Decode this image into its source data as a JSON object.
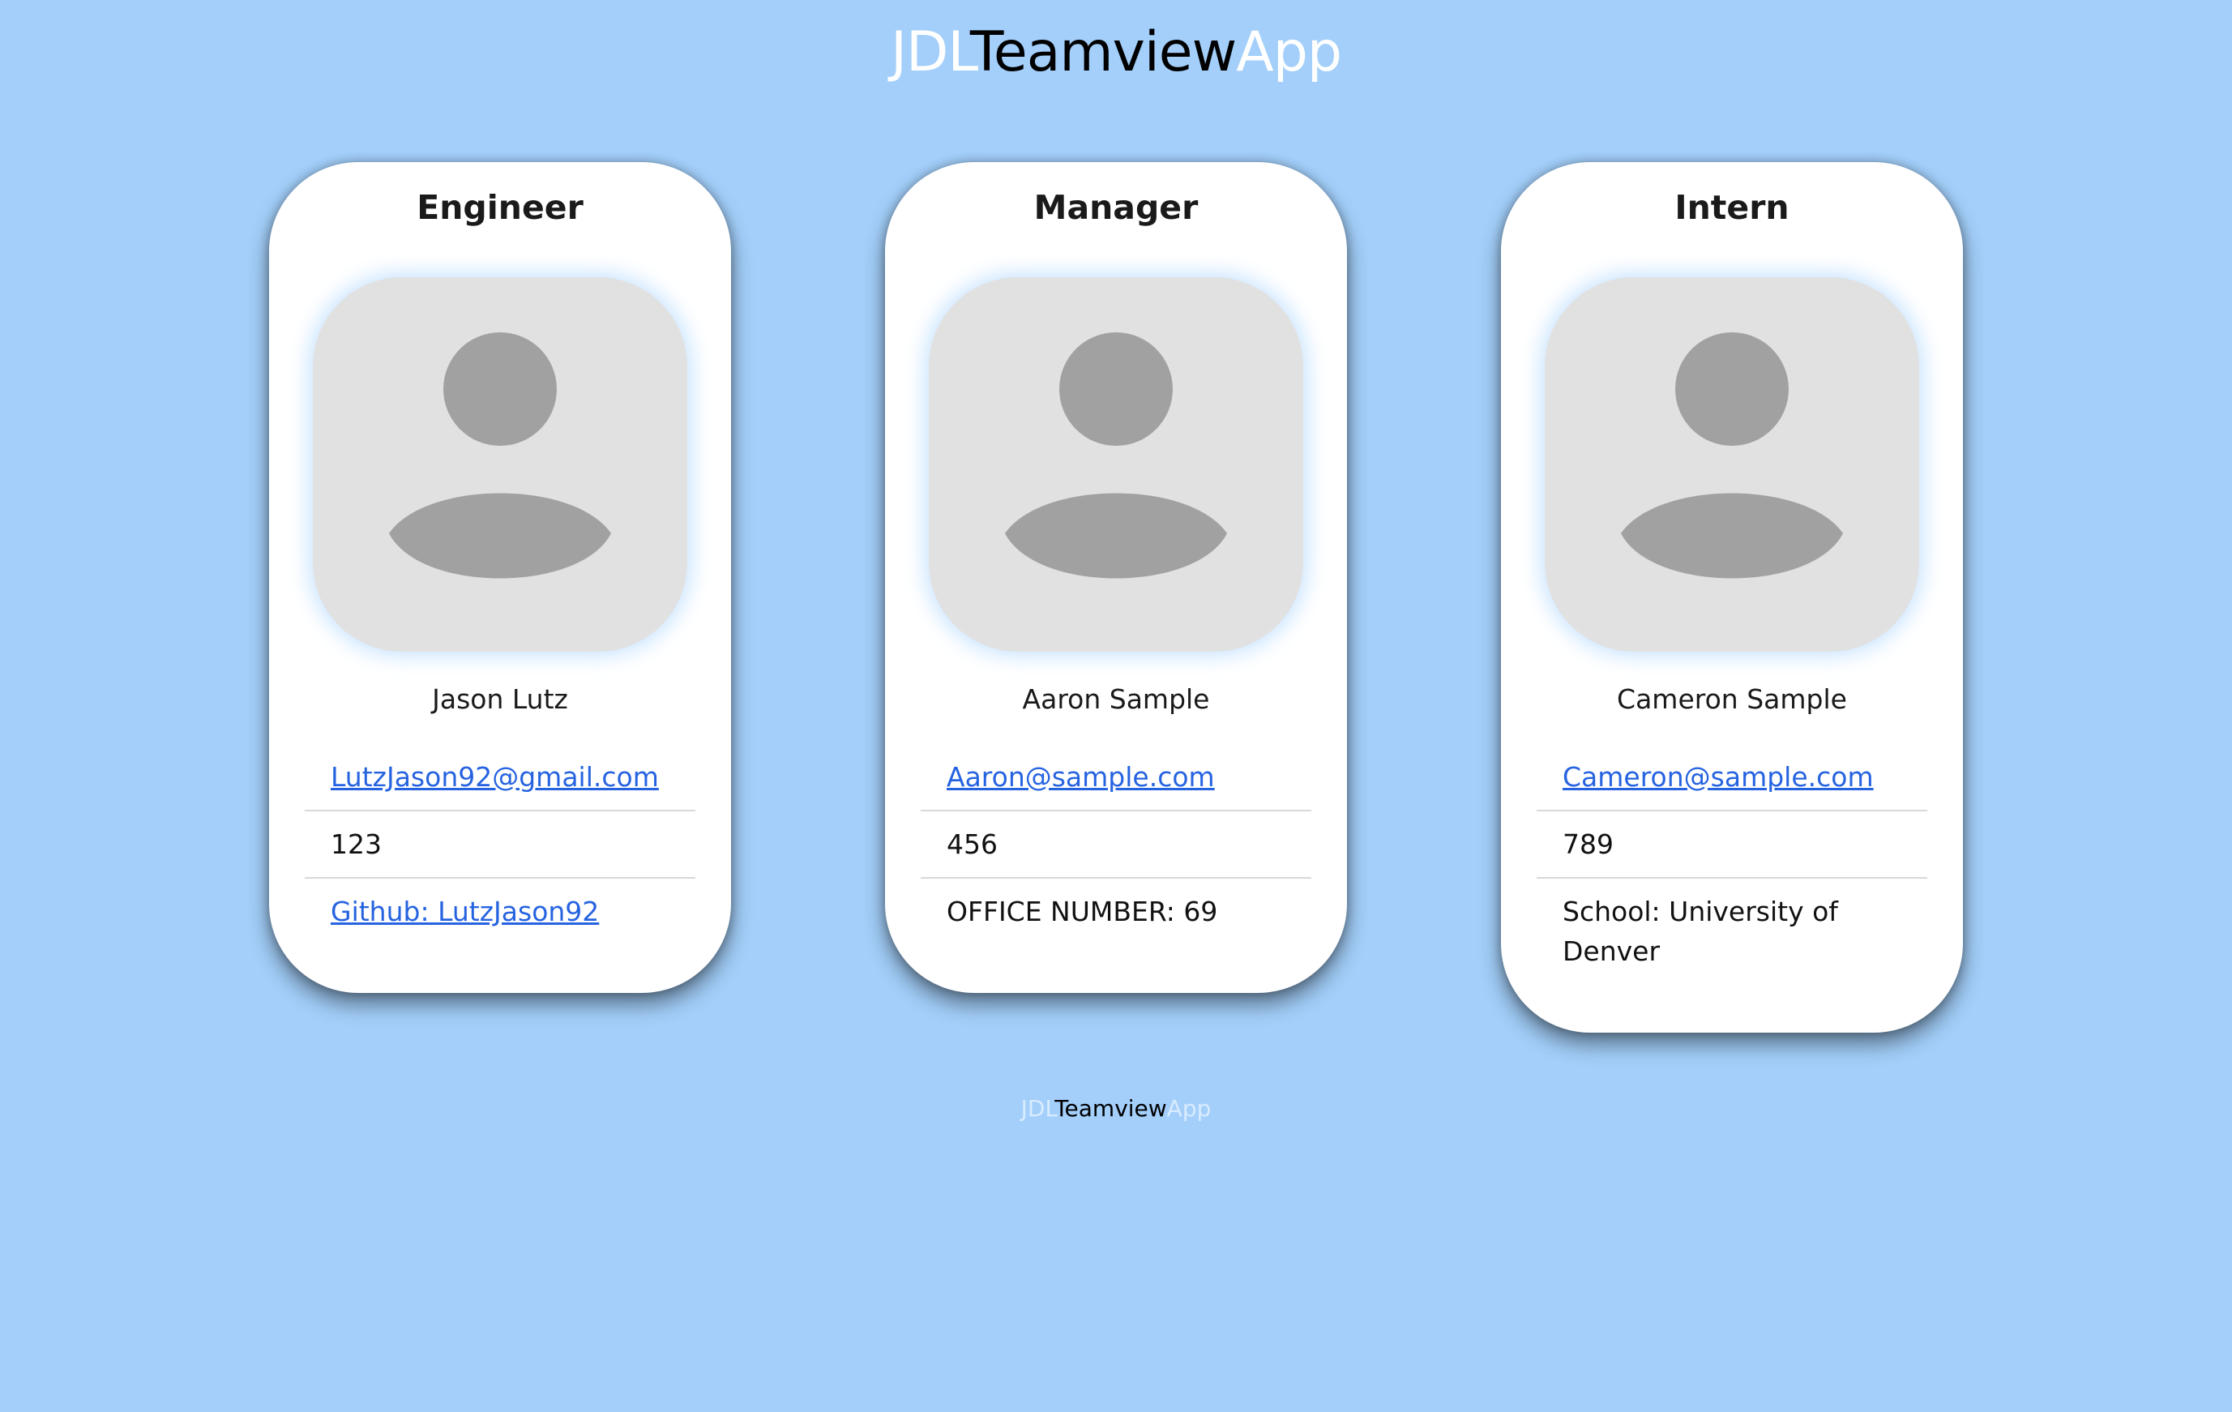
{
  "header": {
    "title_part1": "JDL",
    "title_part2": "Teamview",
    "title_part3": "App"
  },
  "cards": [
    {
      "role": "Engineer",
      "name": "Jason Lutz",
      "email": "LutzJason92@gmail.com",
      "id": "123",
      "extra": "Github: LutzJason92",
      "avatar_icon": "person-icon"
    },
    {
      "role": "Manager",
      "name": "Aaron Sample",
      "email": "Aaron@sample.com",
      "id": "456",
      "extra": "OFFICE NUMBER: 69",
      "avatar_icon": "person-icon"
    },
    {
      "role": "Intern",
      "name": "Cameron Sample",
      "email": "Cameron@sample.com",
      "id": "789",
      "extra": "School: University of Denver",
      "avatar_icon": "person-icon"
    }
  ],
  "footer": {
    "part1": "JDL",
    "part2": "Teamview",
    "part3": "App"
  },
  "colors": {
    "background": "#a3cffa",
    "card": "#ffffff",
    "link": "#2663e0",
    "avatar_bg": "#e1e1e1",
    "avatar_fg": "#a1a1a1"
  }
}
